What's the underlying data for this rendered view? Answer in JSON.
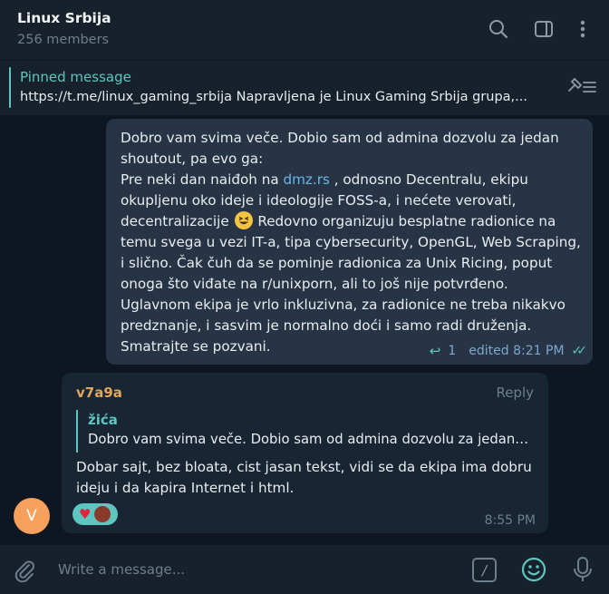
{
  "header": {
    "title": "Linux Srbija",
    "subtitle": "256 members",
    "icons": [
      "search-icon",
      "sidebar-toggle-icon",
      "more-vertical-icon"
    ]
  },
  "pinned": {
    "title": "Pinned message",
    "text": "https://t.me/linux_gaming_srbija  Napravljena je Linux Gaming Srbija grupa,...",
    "icon": "pin-list-icon"
  },
  "outgoing_message": {
    "line1": "Dobro vam svima veče. Dobio sam od admina dozvolu za jedan shoutout, pa evo ga:",
    "line2_before": "Pre neki dan naiđoh na ",
    "link": "dmz.rs",
    "line2_after": " , odnosno Decentralu, ekipu okupljenu oko ideje i ideologije FOSS-a, i nećete verovati, decentralizacije ",
    "line2_after2": " Redovno organizuju besplatne radionice na temu svega u vezi IT-a, tipa cybersecurity, OpenGL, Web Scraping, i slično. Čak čuh da se pominje radionica za Unix Ricing, poput onoga što viđate na r/unixporn, ali to još nije potvrđeno.",
    "line3": "Uglavnom ekipa je vrlo inkluzivna, za radionice ne treba nikakvo predznanje, i sasvim je normalno doći i samo radi druženja.",
    "line4": "Smatrajte se pozvani.",
    "reply_count": "1",
    "meta": "edited 8:21 PM",
    "emoji": "grinning-squinting-face"
  },
  "incoming_message": {
    "author": "v7a9a",
    "reply_label": "Reply",
    "quote_author": "žića",
    "quote_text": "Dobro vam svima veče. Dobio sam od admina dozvolu za jedan ...",
    "text": "Dobar sajt, bez bloata, cist jasan tekst, vidi se da ekipa ima dobru ideju i da kapira Internet i html.",
    "time": "8:55 PM",
    "reaction": "heart"
  },
  "avatar_letter": "V",
  "composer": {
    "placeholder": "Write a message...",
    "command_symbol": "/"
  },
  "colors": {
    "accent": "#5ec6c0",
    "author": "#e4a65b",
    "avatar": "#f5a05c",
    "header_bg": "#17212b",
    "chat_bg": "#0e1621"
  }
}
